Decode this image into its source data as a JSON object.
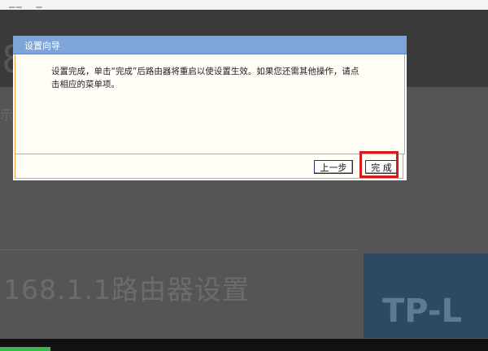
{
  "background": {
    "top_glyphs": "' ̲ ̲ '  ̲",
    "band_digit": "8",
    "side_text": "示",
    "page_title": "168.1.1路由器设置",
    "banner_text": "TP-L"
  },
  "dialog": {
    "title": "设置向导",
    "message": "设置完成，单击“完成”后路由器将重启以使设置生效。如果您还需其他操作，请点击相应的菜单项。",
    "buttons": {
      "prev_label": "上一步",
      "finish_label": "完 成"
    }
  },
  "colors": {
    "header": "#7fa5d8",
    "border_accent": "#f0a040",
    "highlight": "#d41a1a"
  }
}
